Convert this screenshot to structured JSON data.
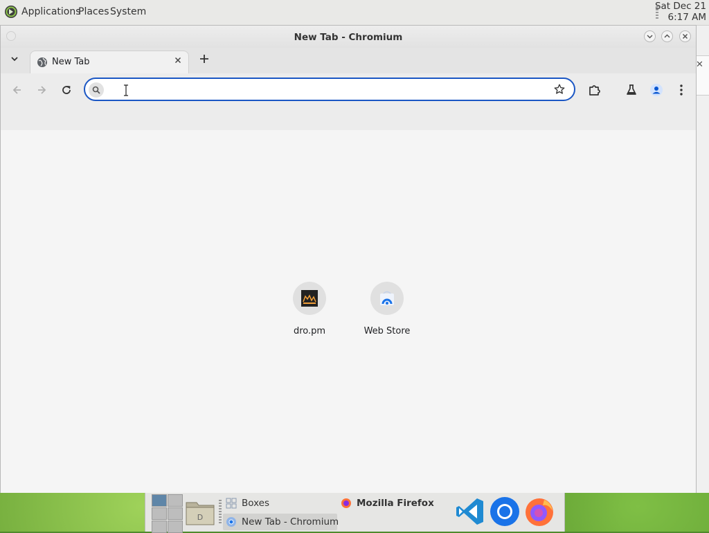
{
  "top_panel": {
    "menus": [
      "Applications",
      "Places",
      "System"
    ],
    "clock": {
      "date": "Sat Dec 21",
      "time": "6:17 AM"
    }
  },
  "window": {
    "title": "New Tab - Chromium",
    "tab": {
      "title": "New Tab"
    },
    "omnibox": {
      "value": "",
      "placeholder": ""
    }
  },
  "shortcuts": [
    {
      "label": "dro.pm"
    },
    {
      "label": "Web Store"
    }
  ],
  "taskbar": {
    "tasks": [
      {
        "label": "Boxes"
      },
      {
        "label": "Mozilla Firefox"
      },
      {
        "label": "New Tab - Chromium"
      }
    ],
    "launchers": [
      "vscode-icon",
      "chromium-icon",
      "firefox-icon"
    ]
  },
  "colors": {
    "accent": "#1a56c4",
    "panel": "#e9e9e7",
    "content_bg": "#f5f5f5"
  }
}
